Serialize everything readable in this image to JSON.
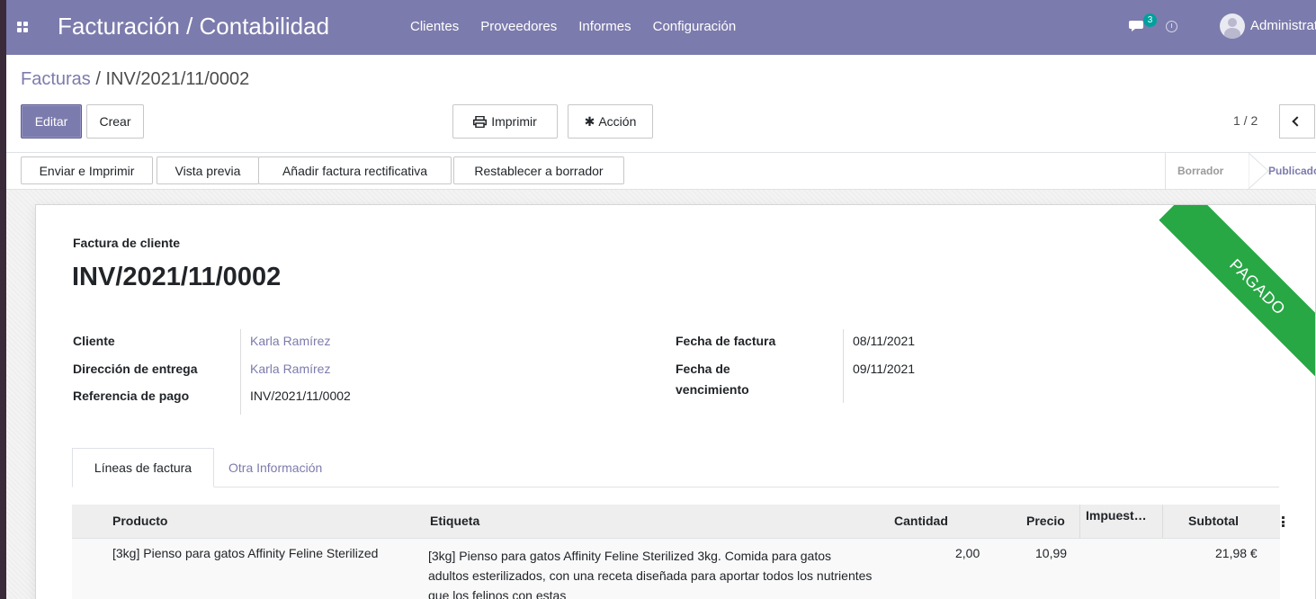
{
  "navbar": {
    "app_title": "Facturación / Contabilidad",
    "menu": [
      "Clientes",
      "Proveedores",
      "Informes",
      "Configuración"
    ],
    "chat_badge": "3",
    "user_name": "Administrator",
    "bg_color": "#7c7bad"
  },
  "breadcrumb": {
    "parent": "Facturas",
    "separator": " / ",
    "current": "INV/2021/11/0002"
  },
  "control": {
    "edit_label": "Editar",
    "create_label": "Crear",
    "print_label": "Imprimir",
    "action_label": "Acción",
    "pager": "1 / 2"
  },
  "status_buttons": {
    "send_print": "Enviar e Imprimir",
    "preview": "Vista previa",
    "add_credit_note": "Añadir factura rectificativa",
    "reset_draft": "Restablecer a borrador"
  },
  "stages": {
    "draft": "Borrador",
    "posted": "Publicado"
  },
  "document": {
    "subtitle": "Factura de cliente",
    "number": "INV/2021/11/0002",
    "ribbon": "PAGADO",
    "ribbon_color": "#28a745"
  },
  "fields": {
    "customer_label": "Cliente",
    "customer_value": "Karla Ramírez",
    "delivery_label": "Dirección de entrega",
    "delivery_value": "Karla Ramírez",
    "payment_ref_label": "Referencia de pago",
    "payment_ref_value": "INV/2021/11/0002",
    "invoice_date_label": "Fecha de factura",
    "invoice_date_value": "08/11/2021",
    "due_date_label_1": "Fecha de",
    "due_date_label_2": "vencimiento",
    "due_date_value": "09/11/2021"
  },
  "tabs": {
    "lines": "Líneas de factura",
    "other": "Otra Información"
  },
  "table": {
    "headers": {
      "product": "Producto",
      "label": "Etiqueta",
      "quantity": "Cantidad",
      "price": "Precio",
      "taxes": "Impuest…",
      "subtotal": "Subtotal"
    },
    "rows": [
      {
        "product": "[3kg] Pienso para gatos Affinity Feline Sterilized",
        "label": "[3kg] Pienso para gatos Affinity Feline Sterilized 3kg. Comida para gatos adultos esterilizados, con una receta diseñada para aportar todos los nutrientes que los felinos con estas",
        "quantity": "2,00",
        "price": "10,99",
        "taxes": "",
        "subtotal": "21,98 €"
      }
    ]
  }
}
